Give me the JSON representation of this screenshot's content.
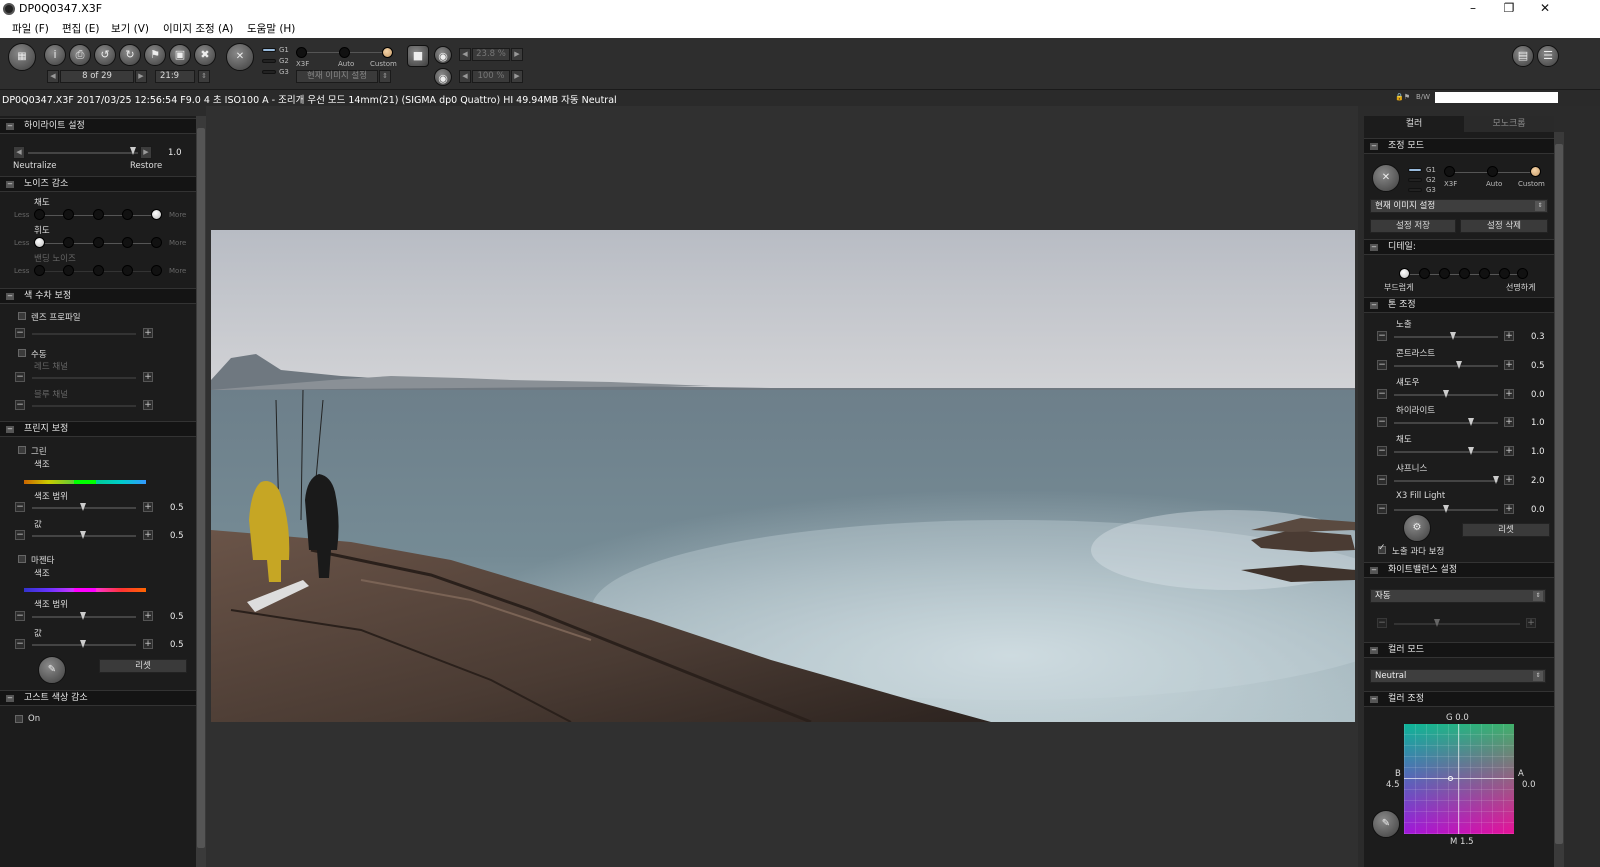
{
  "window": {
    "title": "DP0Q0347.X3F",
    "min": "–",
    "restore": "❐",
    "close": "✕"
  },
  "menu": [
    "파일 (F)",
    "편집 (E)",
    "보기 (V)",
    "이미지 조정 (A)",
    "도움말 (H)"
  ],
  "toolbar": {
    "counter": "8 of 29",
    "ratio": "21:9",
    "mode_labels": {
      "g1": "G1",
      "g2": "G2",
      "g3": "G3",
      "x3f": "X3F",
      "auto": "Auto",
      "custom": "Custom"
    },
    "preset": "현재 이미지 설정",
    "zoom1": "23.8 %",
    "zoom2": "100 %"
  },
  "info": "DP0Q0347.X3F 2017/03/25 12:56:54 F9.0 4 초 ISO100 A - 조리개 우선 모드 14mm(21) (SIGMA dp0 Quattro) HI 49.94MB 자동 Neutral",
  "bw_label": "B/W",
  "left": {
    "highlight": {
      "title": "하이라이트 설정",
      "neutralize": "Neutralize",
      "restore": "Restore",
      "value": "1.0"
    },
    "noise": {
      "title": "노이즈 감소",
      "chroma": "채도",
      "luma": "휘도",
      "banding": "밴딩 노이즈",
      "less": "Less",
      "more": "More"
    },
    "chroma_ab": {
      "title": "색 수차 보정",
      "lens_profile": "렌즈 프로파일",
      "manual": "수동",
      "red": "레드 채널",
      "blue": "블루 채널"
    },
    "fringe": {
      "title": "프린지 보정",
      "green": "그린",
      "magenta": "마젠타",
      "hue": "색조",
      "hue_range": "색조 범위",
      "amount": "값",
      "g_range": "0.5",
      "g_amount": "0.5",
      "m_range": "0.5",
      "m_amount": "0.5",
      "reset": "리셋"
    },
    "ghost": {
      "title": "고스트 색상 감소",
      "on": "On"
    }
  },
  "right": {
    "tabs": [
      "컬러",
      "모노크롬"
    ],
    "adjust_mode": {
      "title": "조정 모드",
      "preset": "현재 이미지 설정",
      "save": "설정 저장",
      "delete": "설정 삭제"
    },
    "detail": {
      "title": "디테일:",
      "soft": "부드럽게",
      "sharp": "선명하게"
    },
    "tone": {
      "title": "톤 조정",
      "items": [
        {
          "label": "노출",
          "value": "0.3"
        },
        {
          "label": "콘트라스트",
          "value": "0.5"
        },
        {
          "label": "섀도우",
          "value": "0.0"
        },
        {
          "label": "하이라이트",
          "value": "1.0"
        },
        {
          "label": "채도",
          "value": "1.0"
        },
        {
          "label": "샤프니스",
          "value": "2.0"
        },
        {
          "label": "X3 Fill Light",
          "value": "0.0"
        }
      ],
      "reset": "리셋",
      "overexp": "노출 과다 보정"
    },
    "wb": {
      "title": "화이트밸런스 설정",
      "value": "자동"
    },
    "colormode": {
      "title": "컬러 모드",
      "value": "Neutral"
    },
    "coloradj": {
      "title": "컬러 조정",
      "g": "G 0.0",
      "b": "B",
      "b_val": "4.5",
      "a": "A",
      "a_val": "0.0",
      "m": "M 1.5"
    }
  }
}
